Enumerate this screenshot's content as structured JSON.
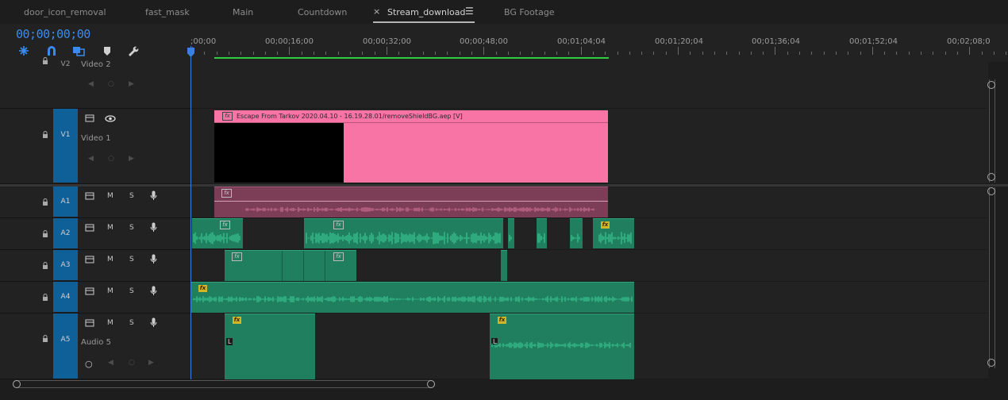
{
  "tabs": [
    {
      "label": "door_icon_removal"
    },
    {
      "label": "fast_mask"
    },
    {
      "label": "Main"
    },
    {
      "label": "Countdown"
    },
    {
      "label": "Stream_download",
      "active": true,
      "close": "×",
      "menu": "☰"
    },
    {
      "label": "BG Footage"
    }
  ],
  "timecode": "00;00;00;00",
  "ruler": {
    "labels": [
      ";00;00",
      "00;00;16;00",
      "00;00;32;00",
      "00;00;48;00",
      "00;01;04;04",
      "00;01;20;04",
      "00;01;36;04",
      "00;01;52;04",
      "00;02;08;0"
    ]
  },
  "tracks": {
    "v2": {
      "id": "V2",
      "name": "Video 2"
    },
    "v1": {
      "id": "V1",
      "name": "Video 1"
    },
    "a1": {
      "id": "A1"
    },
    "a2": {
      "id": "A2"
    },
    "a3": {
      "id": "A3"
    },
    "a4": {
      "id": "A4"
    },
    "a5": {
      "id": "A5",
      "name": "Audio 5"
    }
  },
  "track_buttons": {
    "m": "M",
    "s": "S"
  },
  "clips": {
    "v1_title": "Escape From Tarkov 2020.04.10 - 16.19.28.01/removeShieldBG.aep [V]",
    "fx_label": "fx",
    "keyframe_label": "L"
  },
  "colors": {
    "accent": "#3b8bef",
    "video_clip": "#f774a5",
    "audio_clip": "#1f7f5e",
    "audio_wave": "#3fd49d",
    "track_label": "#0f5f99",
    "workbar": "#2ecc40"
  }
}
